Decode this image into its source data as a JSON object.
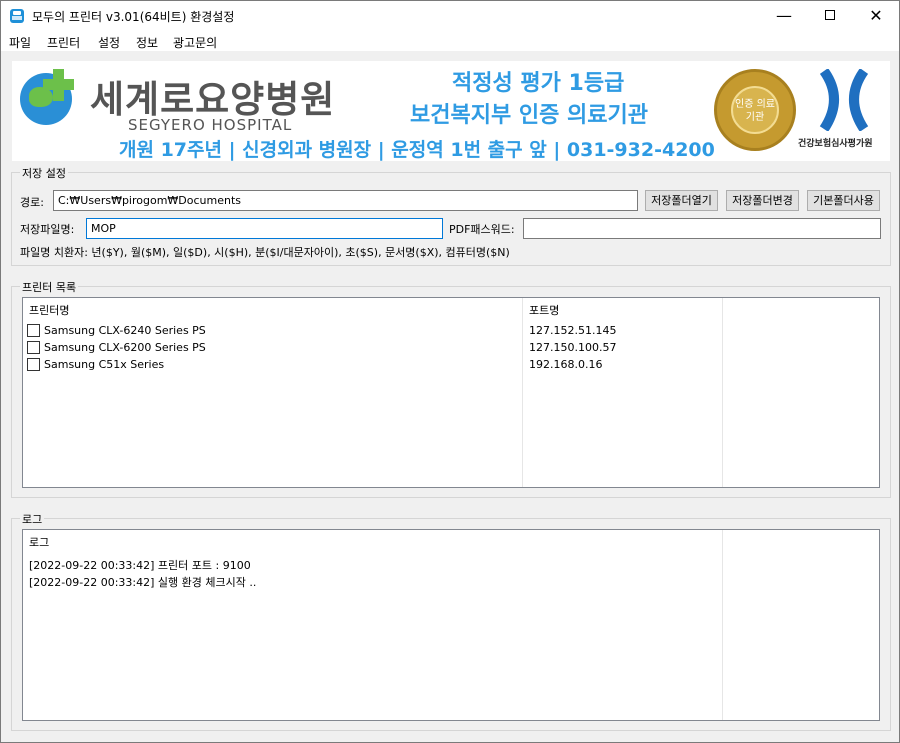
{
  "window": {
    "title": "모두의 프린터 v3.01(64비트) 환경설정",
    "minimize_glyph": "—",
    "close_glyph": "✕"
  },
  "menu": [
    "파일",
    "프린터",
    "설정",
    "정보",
    "광고문의"
  ],
  "banner": {
    "hospital_name": "세계로요양병원",
    "hospital_name_en": "SEGYERO HOSPITAL",
    "eval_line1": "적정성 평가 1등급",
    "eval_line2": "보건복지부 인증 의료기관",
    "info_line": "개원 17주년 | 신경외과 병원장 | 운정역 1번 출구 앞 | 031-932-4200",
    "seal_text": "인증 의료기관",
    "agency_text": "건강보험심사평가원",
    "brand_blue": "#2f9be3",
    "brand_green": "#6cc04a"
  },
  "save_settings": {
    "title": "저장 설정",
    "path_label": "경로:",
    "path_value": "C:₩Users₩pirogom₩Documents",
    "open_folder_btn": "저장폴더열기",
    "change_folder_btn": "저장폴더변경",
    "default_folder_btn": "기본폴더사용",
    "filename_label": "저장파일명:",
    "filename_value": "MOP",
    "pdf_password_label": "PDF패스워드:",
    "pdf_password_value": "",
    "substitution_hint": "파일명 치환자: 년($Y), 월($M), 일($D), 시($H), 분($I/대문자아이), 초($S), 문서명($X), 컴퓨터명($N)"
  },
  "printers": {
    "title": "프린터 목록",
    "columns": [
      "프린터명",
      "포트명"
    ],
    "rows": [
      {
        "name": "Samsung CLX-6240 Series PS",
        "port": "127.152.51.145",
        "checked": false
      },
      {
        "name": "Samsung CLX-6200 Series PS",
        "port": "127.150.100.57",
        "checked": false
      },
      {
        "name": "Samsung C51x Series",
        "port": "192.168.0.16",
        "checked": false
      }
    ]
  },
  "log": {
    "title": "로그",
    "column": "로그",
    "entries": [
      "[2022-09-22 00:33:42] 프린터 포트 : 9100",
      "[2022-09-22 00:33:42] 실행 환경 체크시작 .."
    ]
  }
}
